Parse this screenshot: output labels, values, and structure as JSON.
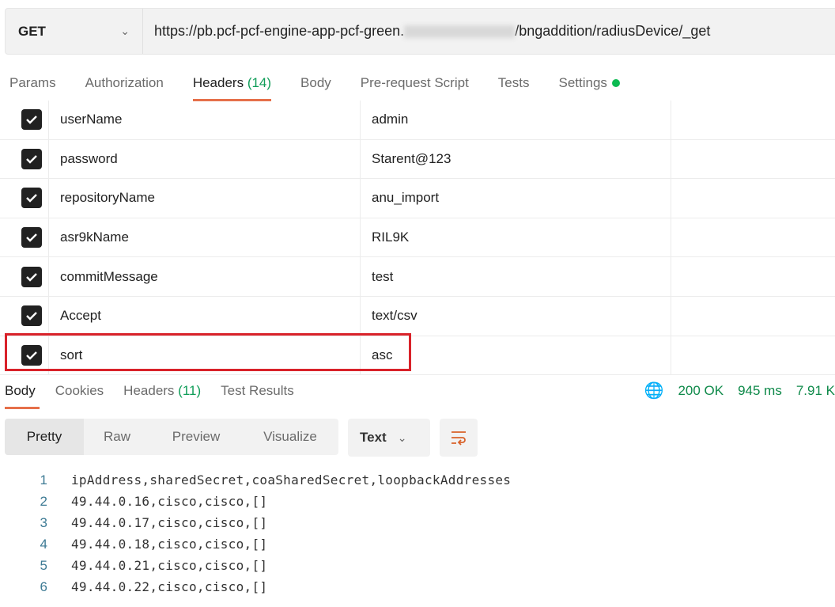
{
  "request": {
    "method": "GET",
    "url_prefix": "https://pb.pcf-pcf-engine-app-pcf-green.",
    "url_suffix": "/bngaddition/radiusDevice/_get"
  },
  "request_tabs": [
    {
      "label": "Params"
    },
    {
      "label": "Authorization"
    },
    {
      "label": "Headers",
      "count": "(14)"
    },
    {
      "label": "Body"
    },
    {
      "label": "Pre-request Script"
    },
    {
      "label": "Tests"
    },
    {
      "label": "Settings"
    }
  ],
  "headers": [
    {
      "key": "userName",
      "value": "admin",
      "checked": true
    },
    {
      "key": "password",
      "value": "Starent@123",
      "checked": true
    },
    {
      "key": "repositoryName",
      "value": "anu_import",
      "checked": true
    },
    {
      "key": "asr9kName",
      "value": "RIL9K",
      "checked": true
    },
    {
      "key": "commitMessage",
      "value": "test",
      "checked": true
    },
    {
      "key": "Accept",
      "value": "text/csv",
      "checked": true
    },
    {
      "key": "sort",
      "value": "asc",
      "checked": true
    }
  ],
  "response_tabs": [
    {
      "label": "Body"
    },
    {
      "label": "Cookies"
    },
    {
      "label": "Headers",
      "count": "(11)"
    },
    {
      "label": "Test Results"
    }
  ],
  "status": {
    "code": "200 OK",
    "time": "945 ms",
    "size": "7.91 K"
  },
  "view_modes": [
    "Pretty",
    "Raw",
    "Preview",
    "Visualize"
  ],
  "format": "Text",
  "body_lines": [
    {
      "n": "1",
      "text": "ipAddress,sharedSecret,coaSharedSecret,loopbackAddresses"
    },
    {
      "n": "2",
      "text": "49.44.0.16,cisco,cisco,[]"
    },
    {
      "n": "3",
      "text": "49.44.0.17,cisco,cisco,[]"
    },
    {
      "n": "4",
      "text": "49.44.0.18,cisco,cisco,[]"
    },
    {
      "n": "5",
      "text": "49.44.0.21,cisco,cisco,[]"
    },
    {
      "n": "6",
      "text": "49.44.0.22,cisco,cisco,[]"
    }
  ],
  "colors": {
    "accent": "#e6704a",
    "highlight": "#d9222a",
    "success": "#0f8a4a"
  }
}
